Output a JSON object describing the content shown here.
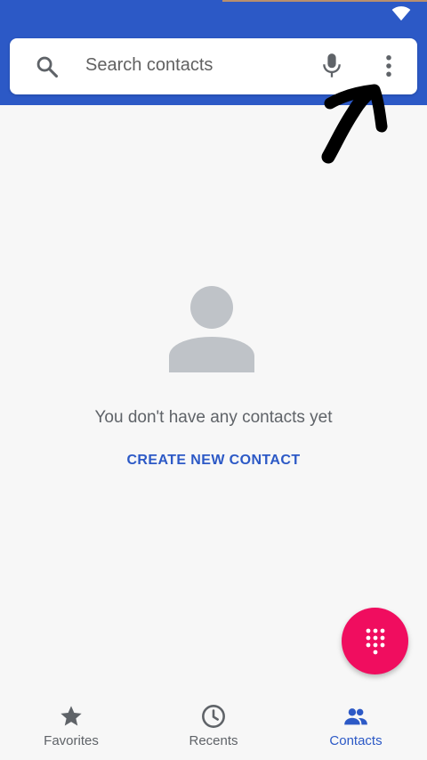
{
  "colors": {
    "app_bar": "#2c59c6",
    "accent": "#2c59c6",
    "fab": "#f00d5f",
    "text_secondary": "#5f6368"
  },
  "status_bar": {
    "icons": [
      "wifi-icon"
    ]
  },
  "search": {
    "placeholder": "Search contacts",
    "left_icon": "search-icon",
    "right_icons": [
      "mic-icon",
      "more-vert-icon"
    ]
  },
  "annotation": {
    "icon": "hand-drawn-arrow-icon"
  },
  "empty_state": {
    "icon": "person-icon",
    "message": "You don't have any contacts yet",
    "action_label": "CREATE NEW CONTACT"
  },
  "fab": {
    "icon": "dialpad-icon"
  },
  "bottom_nav": {
    "items": [
      {
        "label": "Favorites",
        "icon": "star-icon",
        "active": false
      },
      {
        "label": "Recents",
        "icon": "clock-icon",
        "active": false
      },
      {
        "label": "Contacts",
        "icon": "people-icon",
        "active": true
      }
    ]
  }
}
